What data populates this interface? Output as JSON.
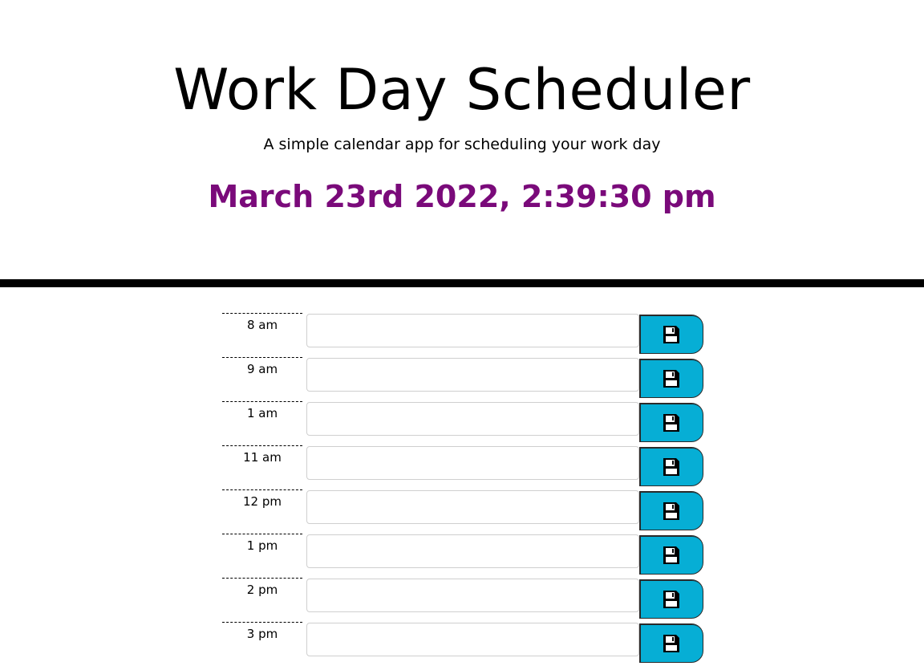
{
  "header": {
    "title": "Work Day Scheduler",
    "subtitle": "A simple calendar app for scheduling your work day",
    "current_datetime": "March 23rd 2022, 2:39:30 pm"
  },
  "colors": {
    "datetime": "#7a0a7a",
    "save_button": "#06aed5",
    "divider": "#000000"
  },
  "schedule": {
    "rows": [
      {
        "hour": "8 am",
        "text": "",
        "icon": "save-icon"
      },
      {
        "hour": "9 am",
        "text": "",
        "icon": "save-icon"
      },
      {
        "hour": "1 am",
        "text": "",
        "icon": "save-icon"
      },
      {
        "hour": "11 am",
        "text": "",
        "icon": "save-icon"
      },
      {
        "hour": "12 pm",
        "text": "",
        "icon": "save-icon"
      },
      {
        "hour": "1 pm",
        "text": "",
        "icon": "save-icon"
      },
      {
        "hour": "2 pm",
        "text": "",
        "icon": "save-icon"
      },
      {
        "hour": "3 pm",
        "text": "",
        "icon": "save-icon"
      }
    ]
  }
}
